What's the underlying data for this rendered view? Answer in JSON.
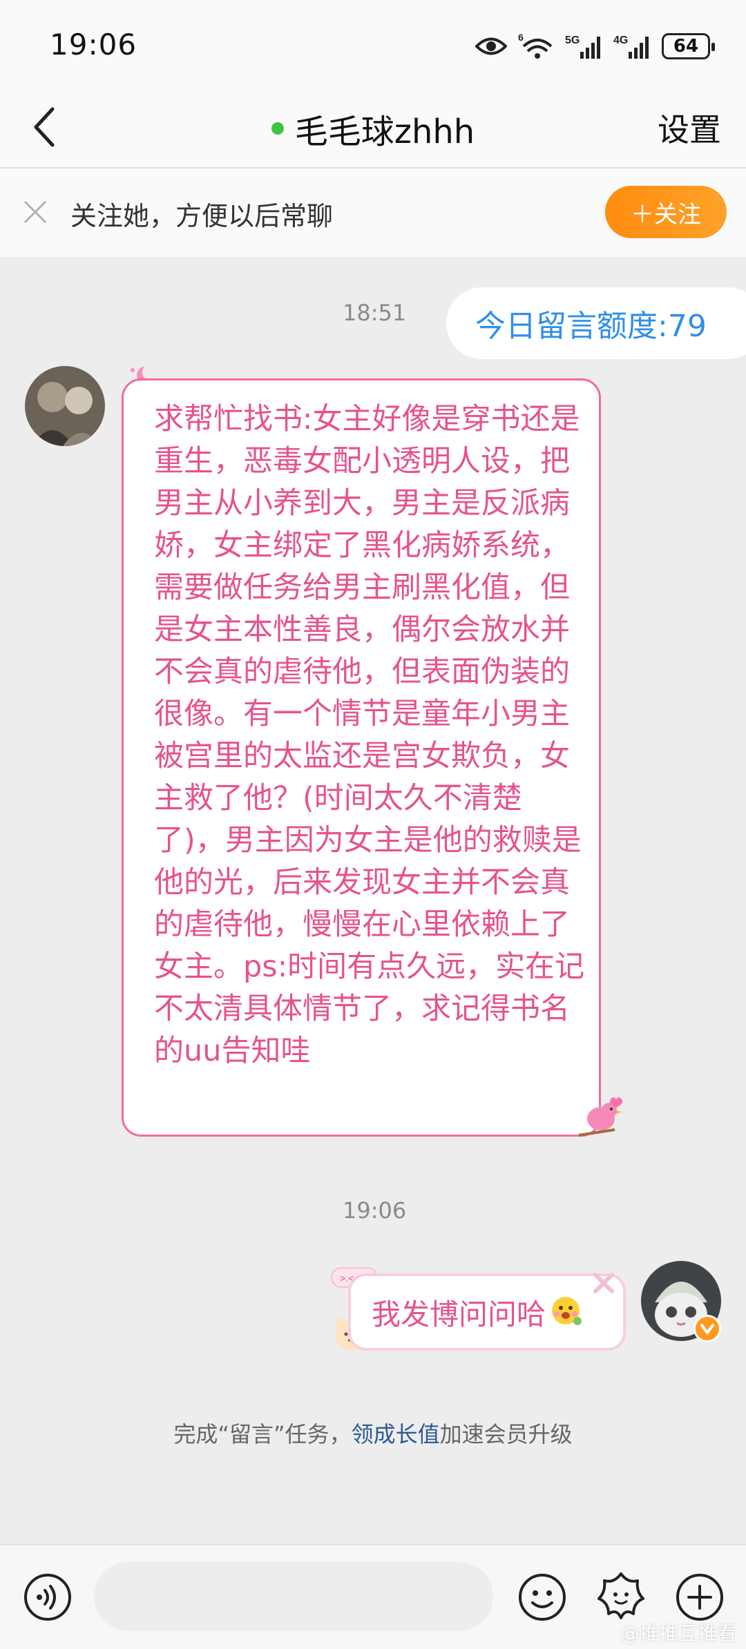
{
  "status_bar": {
    "time": "19:06",
    "battery": "64",
    "icons": [
      "eye-icon",
      "wifi-icon",
      "signal-5g-icon",
      "signal-4g-icon",
      "battery-icon"
    ],
    "network_labels": [
      "6",
      "5G",
      "4G"
    ]
  },
  "header": {
    "back_icon": "chevron-left-icon",
    "title": "毛毛球zhhh",
    "online": true,
    "settings_label": "设置"
  },
  "follow_bar": {
    "text": "关注她，方便以后常聊",
    "button_label": "＋关注",
    "button_color": "#ff9a1f"
  },
  "chat": {
    "messages": [
      {
        "type": "timestamp",
        "text": "18:51"
      },
      {
        "type": "outgoing-system",
        "text": "今日留言额度:79",
        "color": "#2f8fe8"
      },
      {
        "type": "incoming",
        "text": "求帮忙找书:女主好像是穿书还是重生，恶毒女配小透明人设，把男主从小养到大，男主是反派病娇，女主绑定了黑化病娇系统，需要做任务给男主刷黑化值，但是女主本性善良，偶尔会放水并不会真的虐待他，但表面伪装的很像。有一个情节是童年小男主被宫里的太监还是宫女欺负，女主救了他？(时间太久不清楚了)，男主因为女主是他的救赎是他的光，后来发现女主并不会真的虐待他，慢慢在心里依赖上了女主。ps:时间有点久远，实在记不太清具体情节了，求记得书名的uu告知哇",
        "color": "#e5538f"
      },
      {
        "type": "timestamp",
        "text": "19:06"
      },
      {
        "type": "outgoing",
        "text": "我发博问问哈",
        "emoji": "face-emoji-icon"
      }
    ],
    "notice": {
      "prefix": "完成“留言”任务，",
      "link": "领成长值",
      "suffix": "加速会员升级"
    }
  },
  "bottom_bar": {
    "voice_icon": "voice-icon",
    "input_placeholder": "",
    "emoji_icon": "smiley-icon",
    "sticker_icon": "sticker-flower-icon",
    "add_icon": "plus-circle-icon"
  },
  "watermark": "@推推互推看"
}
